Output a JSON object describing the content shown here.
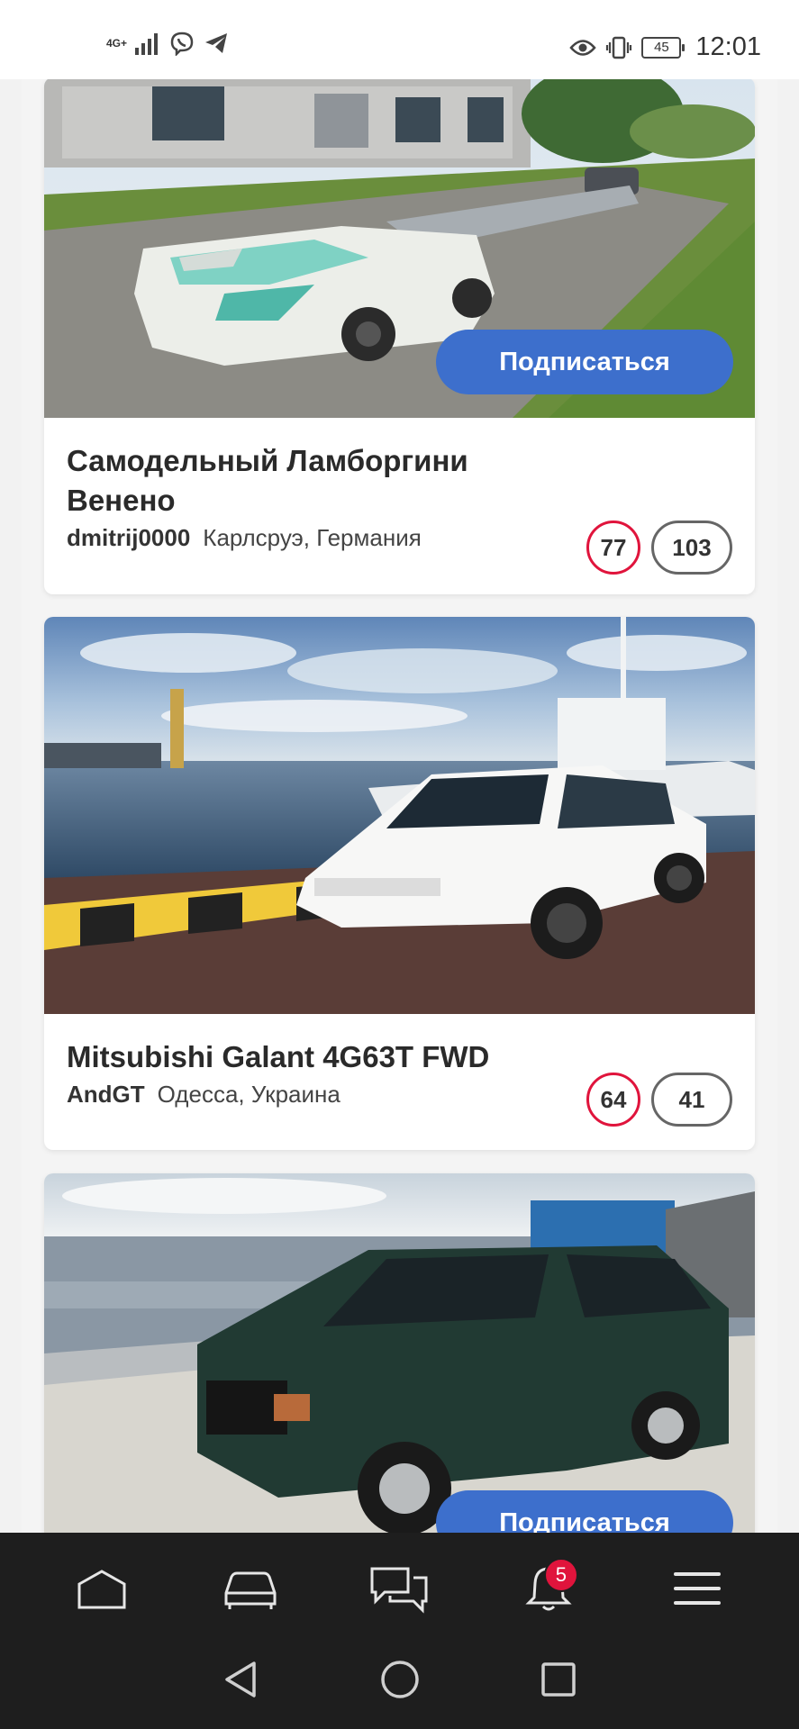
{
  "status_bar": {
    "network_type": "4G+",
    "time": "12:01",
    "battery": "45",
    "icons": [
      "signal-icon",
      "viber-icon",
      "telegram-icon",
      "eye-icon",
      "vibrate-icon",
      "battery-icon"
    ]
  },
  "feed": {
    "subscribe_label": "Подписаться",
    "cards": [
      {
        "title": "Самодельный Ламборгини Венено",
        "author": "dmitrij0000",
        "location": "Карлсруэ, Германия",
        "likes": "77",
        "comments": "103"
      },
      {
        "title": "Mitsubishi Galant 4G63T FWD",
        "author": "AndGT",
        "location": "Одесса, Украина",
        "likes": "64",
        "comments": "41"
      },
      {
        "title": "",
        "author": "",
        "location": ""
      }
    ]
  },
  "bottom_nav": {
    "items": [
      "home-icon",
      "car-icon",
      "chat-icon",
      "bell-icon",
      "menu-icon"
    ],
    "notifications_badge": "5"
  },
  "system_nav": [
    "back-icon",
    "home-circle-icon",
    "recents-icon"
  ],
  "colors": {
    "accent_blue": "#3d6fcc",
    "like_red": "#e0143c",
    "nav_dark": "#1e1e1e"
  }
}
